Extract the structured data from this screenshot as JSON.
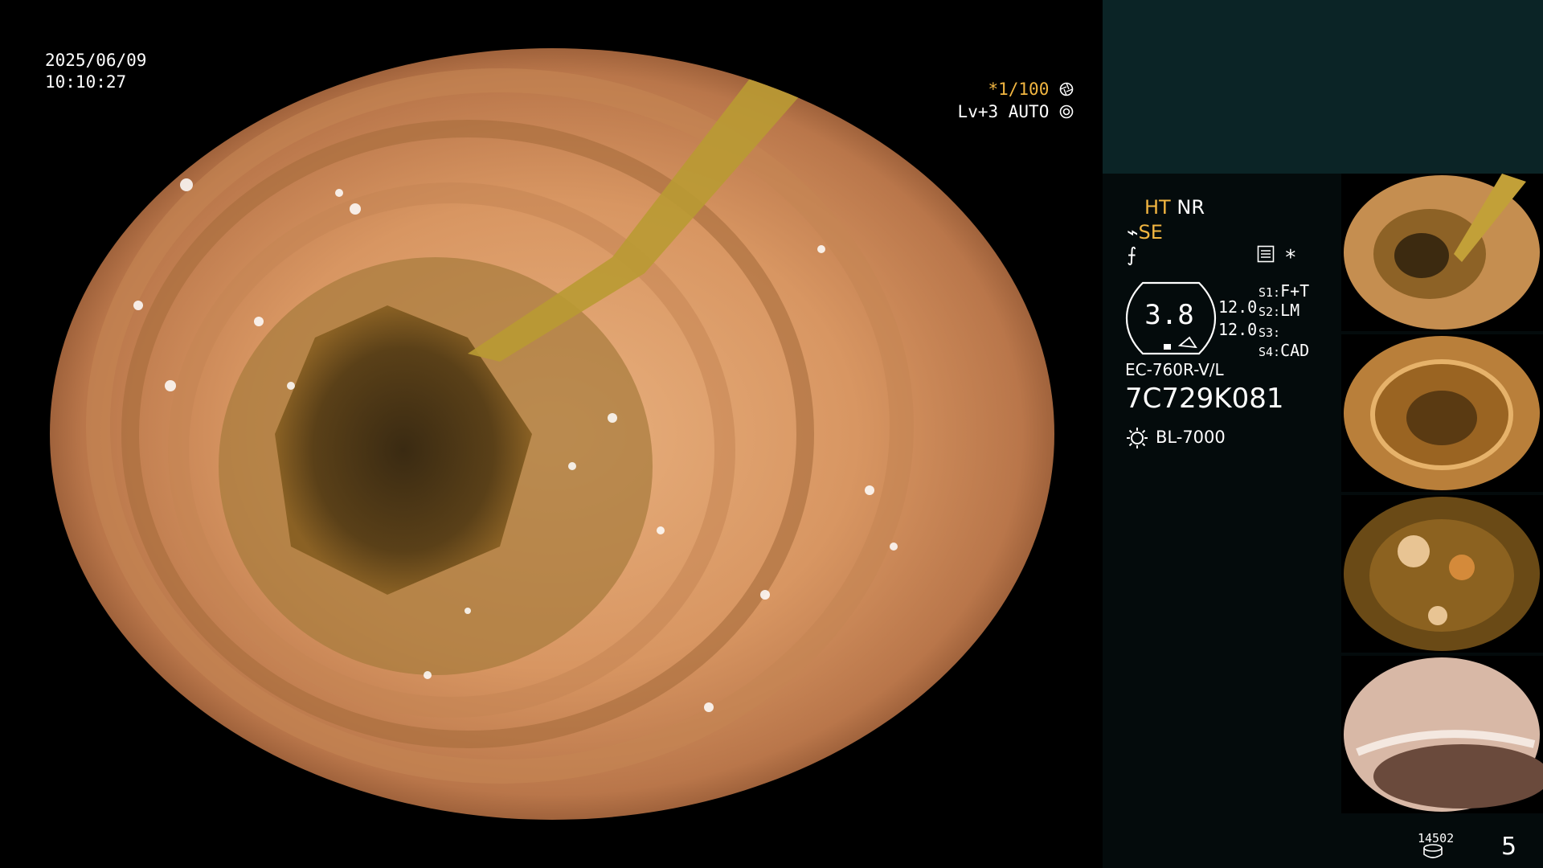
{
  "main": {
    "date": "2025/06/09",
    "time": "10:10:27",
    "shutter_prefix": "*1/100",
    "shutter_icon": "aperture-icon",
    "level": "Lv+3 AUTO",
    "level_icon": "iris-icon"
  },
  "panel": {
    "ht": "HT",
    "nr": "NR",
    "se": "SE",
    "struct_icon": "structure-enhance-icon",
    "menu_icon": "settings-menu-icon",
    "star": "*",
    "gauge_value": "3.8",
    "param_1": "12.0",
    "param_2": "12.0",
    "slots": [
      {
        "key": "S1:",
        "value": "F+T"
      },
      {
        "key": "S2:",
        "value": "LM"
      },
      {
        "key": "S3:",
        "value": ""
      },
      {
        "key": "S4:",
        "value": "CAD"
      }
    ],
    "scope_model": "EC-760R-V/L",
    "scope_serial": "7C729K081",
    "light_source": "BL-7000",
    "image_count": "14502",
    "page_number": "5"
  },
  "colors": {
    "accent": "#f2b641",
    "panel_top": "#0b2426",
    "panel_bg": "#040b0c"
  }
}
